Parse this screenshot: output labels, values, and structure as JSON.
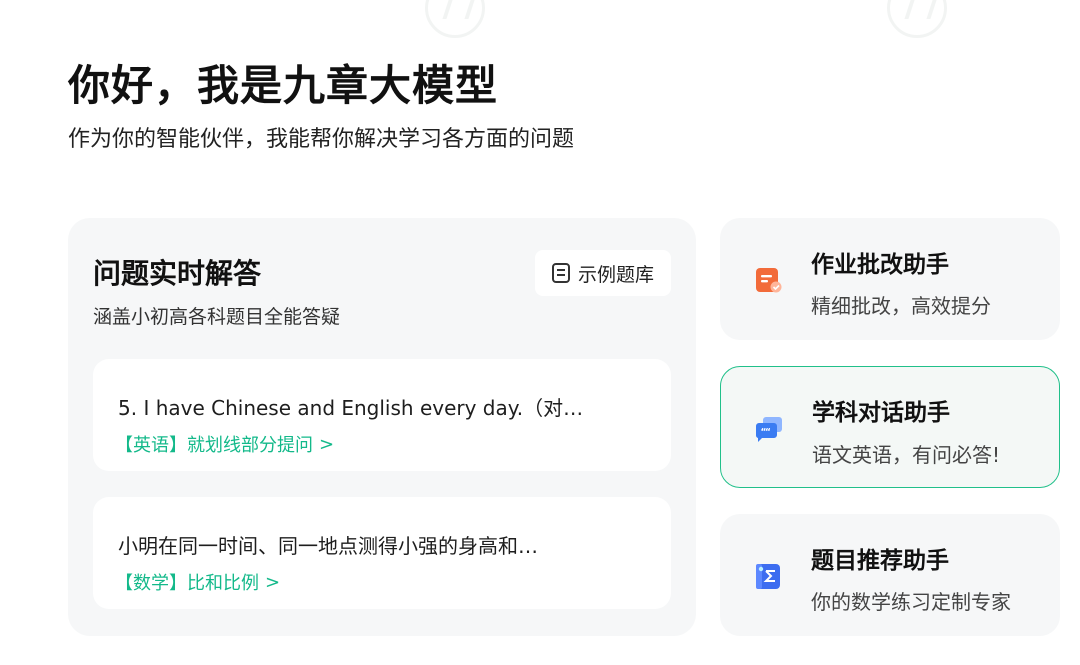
{
  "header": {
    "title": "你好，我是九章大模型",
    "subtitle": "作为你的智能伙伴，我能帮你解决学习各方面的问题"
  },
  "qa_panel": {
    "title": "问题实时解答",
    "subtitle": "涵盖小初高各科题目全能答疑",
    "bank_button": "示例题库",
    "questions": [
      {
        "text": "5. I have Chinese and English every day.（对…",
        "tag": "【英语】就划线部分提问",
        "chevron": ">"
      },
      {
        "text": "小明在同一时间、同一地点测得小强的身高和…",
        "tag": "【数学】比和比例",
        "chevron": ">"
      }
    ]
  },
  "tools": [
    {
      "title": "作业批改助手",
      "subtitle": "精细批改，高效提分",
      "icon": "homework-correction-icon",
      "color": "#f26b3a",
      "selected": false
    },
    {
      "title": "学科对话助手",
      "subtitle": "语文英语，有问必答!",
      "icon": "chat-bubble-icon",
      "color": "#3a7cf2",
      "selected": true
    },
    {
      "title": "题目推荐助手",
      "subtitle": "你的数学练习定制专家",
      "icon": "sigma-book-icon",
      "color": "#3d6df0",
      "selected": false
    }
  ],
  "colors": {
    "accent_green": "#13b98a",
    "selected_border": "#21c08a"
  }
}
